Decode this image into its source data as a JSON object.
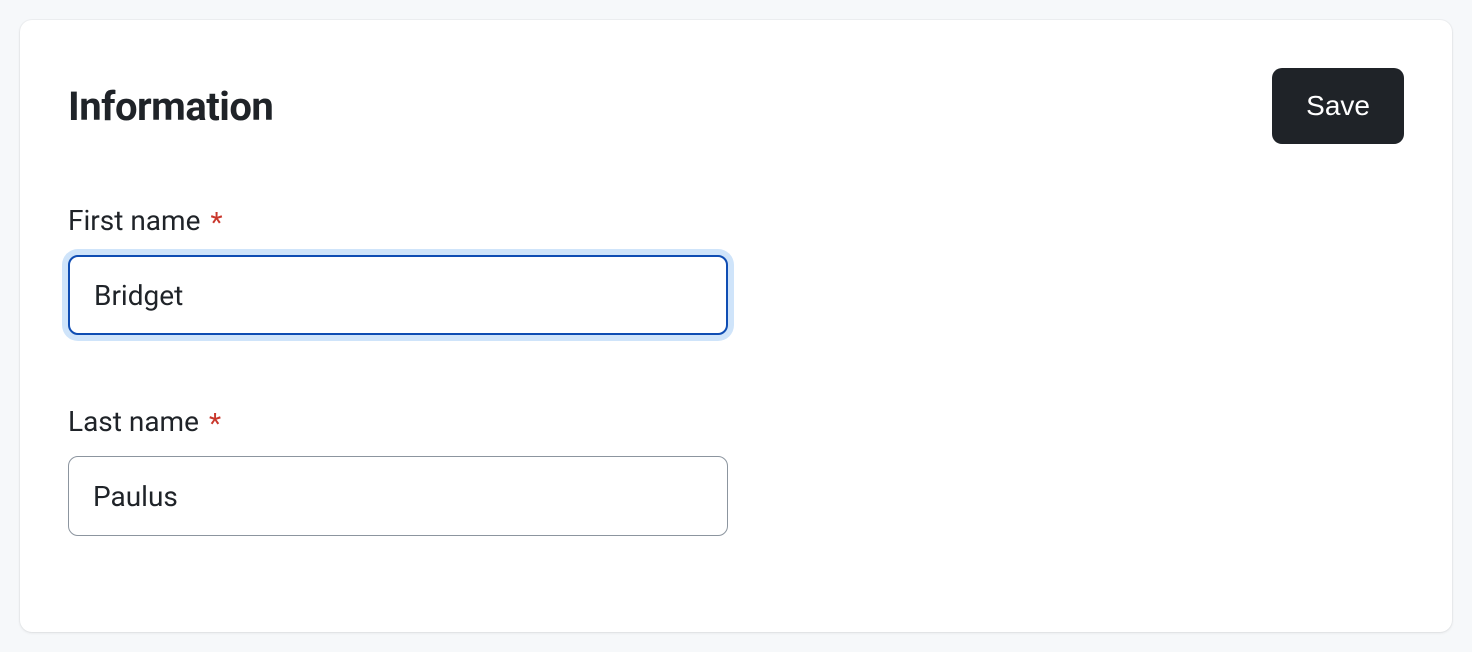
{
  "header": {
    "title": "Information",
    "save_label": "Save"
  },
  "fields": {
    "first_name": {
      "label": "First name",
      "required_mark": "*",
      "value": "Bridget"
    },
    "last_name": {
      "label": "Last name",
      "required_mark": "*",
      "value": "Paulus"
    }
  }
}
